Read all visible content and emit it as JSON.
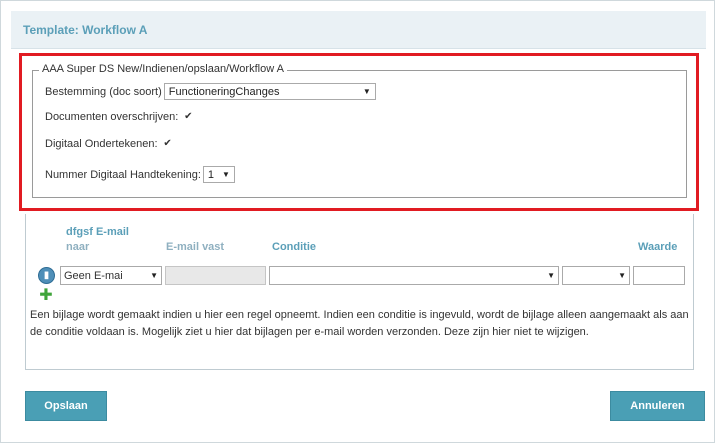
{
  "header": {
    "title": "Template: Workflow A"
  },
  "form": {
    "legend": "AAA Super DS New/Indienen/opslaan/Workflow A",
    "bestemming_label": "Bestemming (doc soort)",
    "bestemming_value": "FunctioneringChanges",
    "overschrijven_label": "Documenten overschrijven:",
    "overschrijven_checked": true,
    "ondertekenen_label": "Digitaal Ondertekenen:",
    "ondertekenen_checked": true,
    "nummer_label": "Nummer Digitaal Handtekening:",
    "nummer_value": "1"
  },
  "table": {
    "col_naar_line1": "dfgsf E-mail",
    "col_naar_line2": "naar",
    "col_email_vast": "E-mail vast",
    "col_conditie": "Conditie",
    "col_waarde": "Waarde",
    "row": {
      "email_naar_value": "Geen E-mai",
      "email_vast_value": "",
      "conditie_value": "",
      "operator_value": "",
      "waarde_value": ""
    }
  },
  "info_text": "Een bijlage wordt gemaakt indien u hier een regel opneemt. Indien een conditie is ingevuld, wordt de bijlage alleen aangemaakt als aan de conditie voldaan is. Mogelijk ziet u hier dat bijlagen per e-mail worden verzonden. Deze zijn hier niet te wijzigen.",
  "buttons": {
    "save": "Opslaan",
    "cancel": "Annuleren"
  },
  "colors": {
    "accent": "#4a9fb5",
    "highlight_border": "#e11b22",
    "header_bg": "#eaf1f5"
  }
}
